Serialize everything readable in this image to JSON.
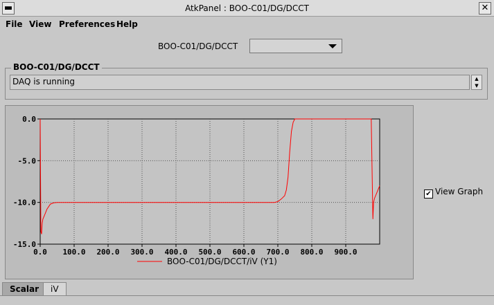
{
  "window": {
    "title": "AtkPanel : BOO-C01/DG/DCCT",
    "close_glyph": "✕"
  },
  "menu": [
    "File",
    "View",
    "Preferences",
    "Help"
  ],
  "device_selector": {
    "label": "BOO-C01/DG/DCCT",
    "value": ""
  },
  "status_group": {
    "title": "BOO-C01/DG/DCCT",
    "text": "DAQ is running"
  },
  "view_graph": {
    "label": "View Graph",
    "checked": true
  },
  "tabs": [
    "Scalar",
    "iV"
  ],
  "chart_data": {
    "type": "line",
    "xlim": [
      0,
      1000
    ],
    "ylim": [
      -15,
      0
    ],
    "xticks": [
      "0.0",
      "100.0",
      "200.0",
      "300.0",
      "400.0",
      "500.0",
      "600.0",
      "700.0",
      "800.0",
      "900.0"
    ],
    "yticks": [
      "0.0",
      "-5.0",
      "-10.0",
      "-15.0"
    ],
    "grid": true,
    "series": [
      {
        "name": "BOO-C01/DG/DCCT/iV (Y1)",
        "color": "#ff0000",
        "x": [
          0,
          2,
          4,
          6,
          8,
          10,
          15,
          20,
          30,
          40,
          50,
          100,
          200,
          300,
          400,
          500,
          600,
          650,
          690,
          700,
          710,
          720,
          725,
          730,
          735,
          740,
          745,
          750,
          755,
          800,
          900,
          975,
          978,
          980,
          982,
          985,
          990,
          1000
        ],
        "y": [
          0,
          -13.5,
          -13.8,
          -12.5,
          -12,
          -11.8,
          -11.3,
          -10.8,
          -10.2,
          -10.05,
          -10,
          -10,
          -10,
          -10,
          -10,
          -10,
          -10,
          -10,
          -10,
          -9.9,
          -9.6,
          -9.2,
          -8.5,
          -7,
          -4,
          -1.5,
          -0.4,
          0,
          0,
          0,
          0,
          0,
          -7,
          -12,
          -10,
          -9.5,
          -9,
          -8
        ]
      }
    ]
  }
}
